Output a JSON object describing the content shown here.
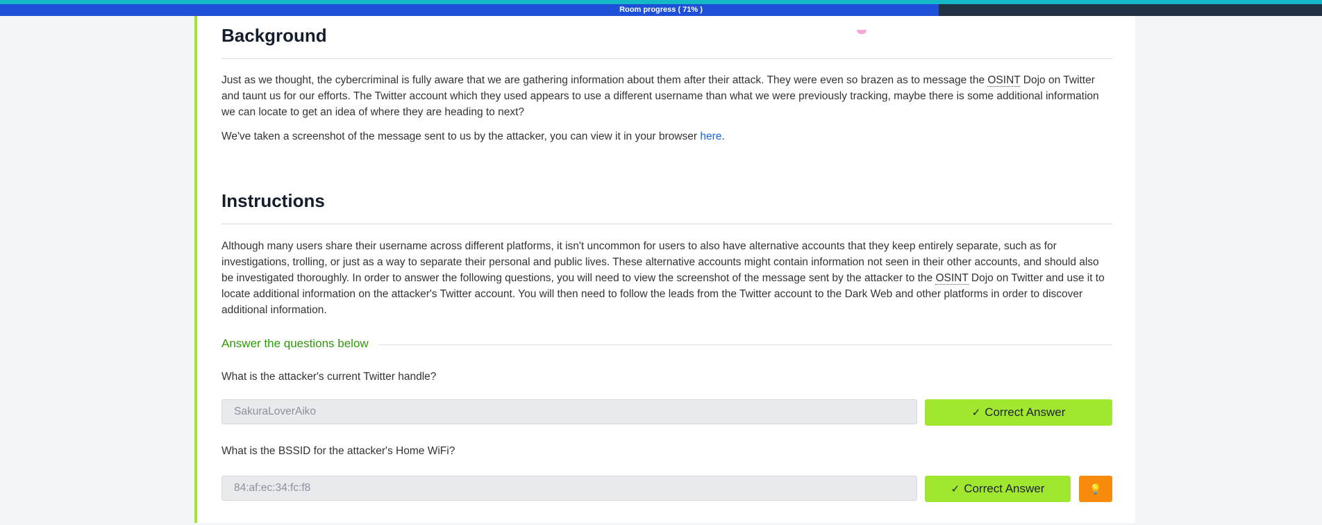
{
  "progress": {
    "label": "Room progress ( 71% )",
    "percent": 71
  },
  "background": {
    "heading": "Background",
    "para1_a": "Just as we thought, the cybercriminal is fully aware that we are gathering information about them after their attack. They were even so brazen as to message the ",
    "abbr_osint": "OSINT",
    "para1_b": " Dojo on Twitter and taunt us for our efforts. The Twitter account which they used appears to use a different username than what we were previously tracking, maybe there is some additional information we can locate to get an idea of where they are heading to next?",
    "para2_a": "We've taken a screenshot of the message sent to us by the attacker, you can view it in your browser ",
    "para2_link": "here",
    "para2_b": "."
  },
  "instructions": {
    "heading": "Instructions",
    "para_a": "Although many users share their username across different platforms, it isn't uncommon for users to also have alternative accounts that they keep entirely separate, such as for investigations, trolling, or just as a way to separate their personal and public lives. These alternative accounts might contain information not seen in their other accounts, and should also be investigated thoroughly. In order to answer the following questions, you will need to view the screenshot of the message sent by the attacker to the ",
    "abbr_osint": "OSINT",
    "para_b": " Dojo on Twitter and use it to locate additional information on the attacker's Twitter account. You will then need to follow the leads from the Twitter account to the Dark Web and other platforms in order to discover additional information."
  },
  "answers": {
    "heading": "Answer the questions below",
    "questions": [
      {
        "question": "What is the attacker's current Twitter handle?",
        "value": "SakuraLoverAiko",
        "button": "Correct Answer",
        "check_icon": "✓"
      },
      {
        "question": "What is the BSSID for the attacker's Home WiFi?",
        "value": "84:af:ec:34:fc:f8",
        "button": "Correct Answer",
        "check_icon": "✓",
        "hint_icon": "💡"
      }
    ]
  },
  "colors": {
    "accent_green": "#a2e72f",
    "progress_blue": "#1f51d8",
    "hint_orange": "#f98b0c",
    "answer_heading_green": "#2f9a0a"
  }
}
